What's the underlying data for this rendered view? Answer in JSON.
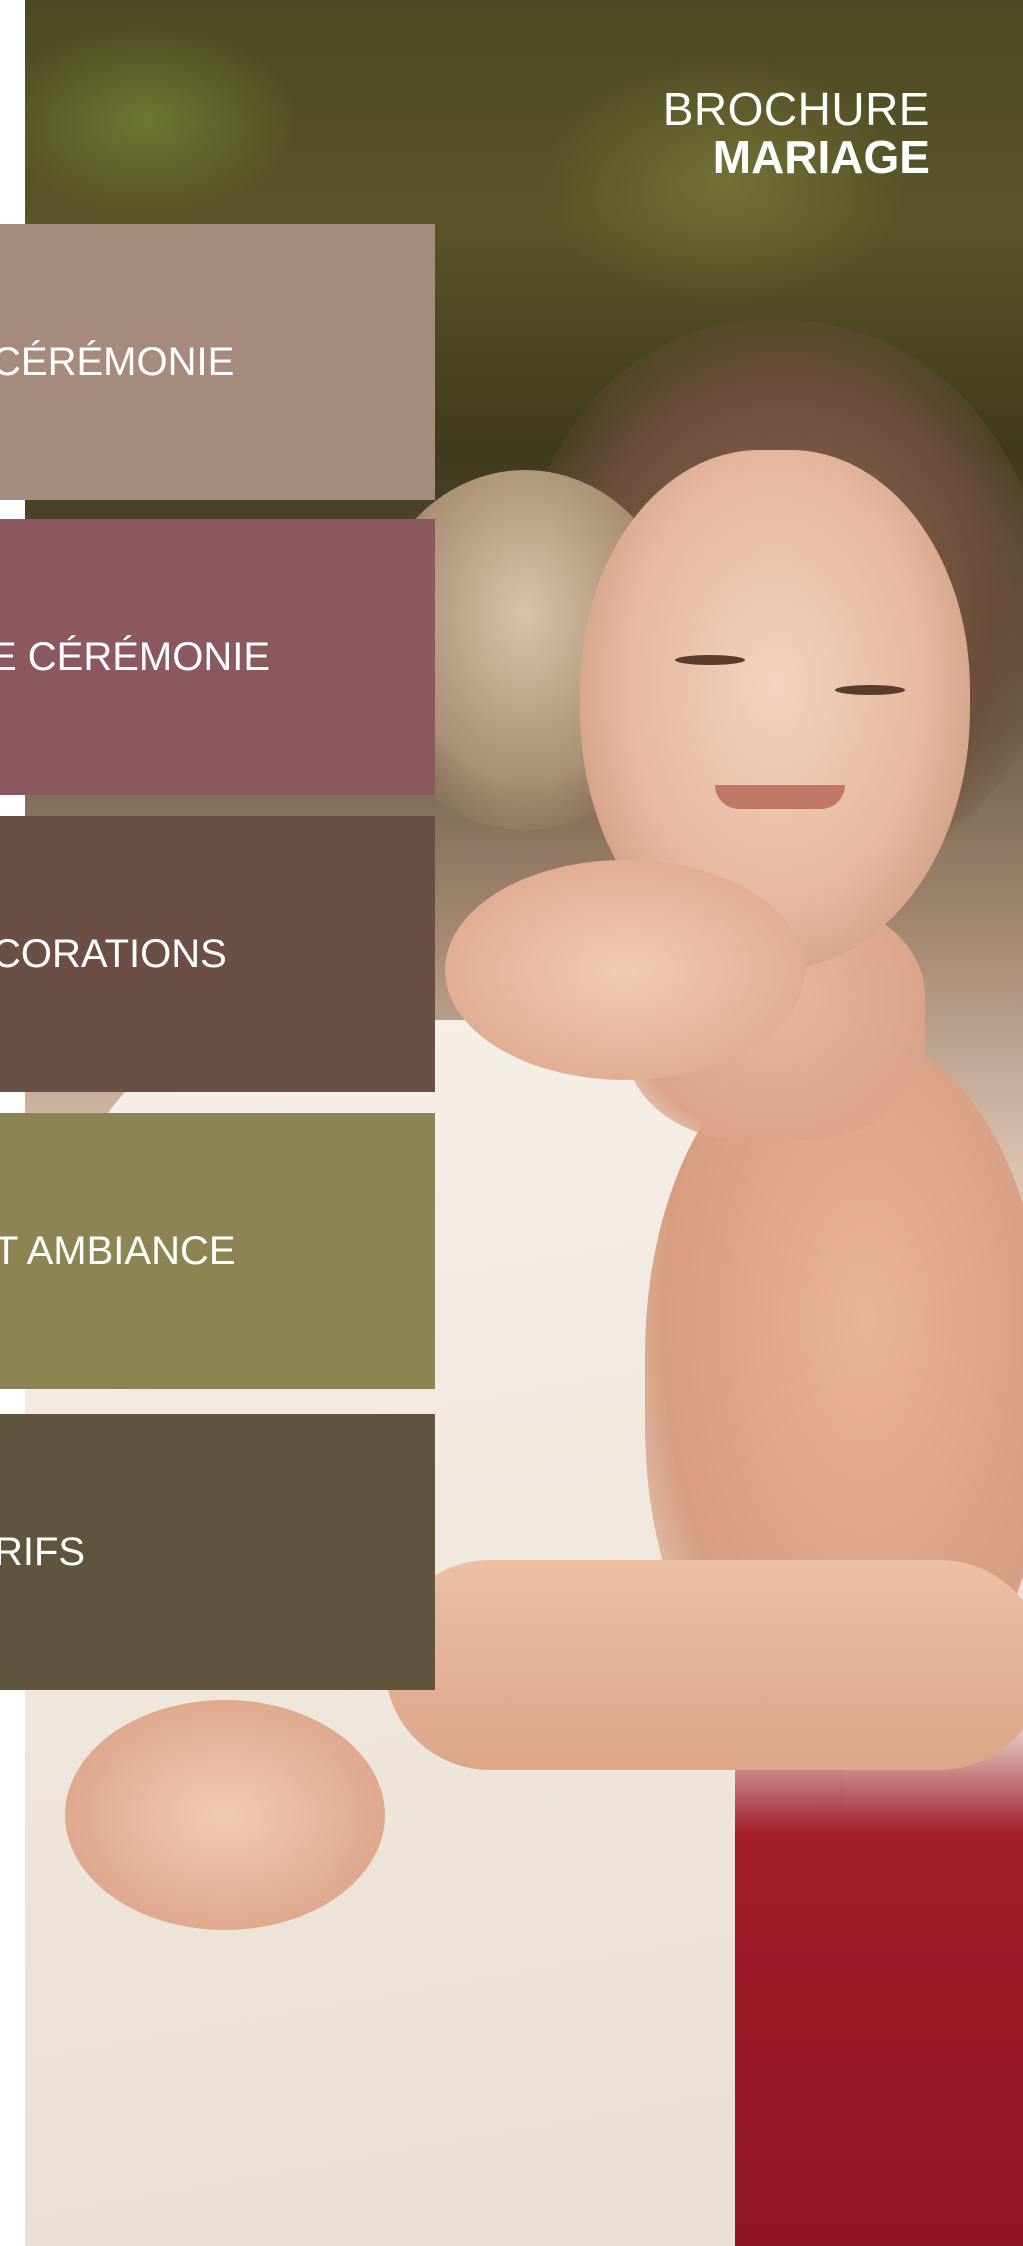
{
  "brand": {
    "line1": "BROCHURE",
    "line2": "MARIAGE"
  },
  "sections": [
    {
      "label": "CÉRÉMONIE",
      "color": "#a68a7e"
    },
    {
      "label": "E CÉRÉMONIE",
      "color": "#8c5860"
    },
    {
      "label": "CORATIONS",
      "color": "#6b4e46"
    },
    {
      "label": "T AMBIANCE",
      "color": "#8c8452"
    },
    {
      "label": "RIFS",
      "color": "#5f553c"
    }
  ],
  "photo": {
    "description_icon": "wedding-photo"
  }
}
